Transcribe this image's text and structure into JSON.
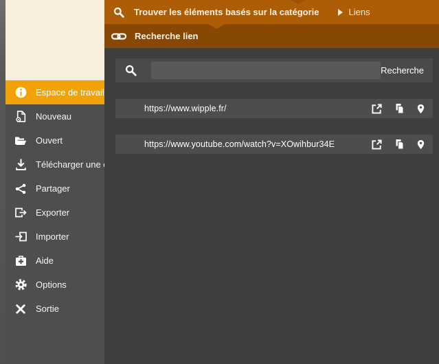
{
  "colors": {
    "topbar_orange": "#AC5D05",
    "subbar_brown": "#874803",
    "selected_orange": "#F2A206",
    "cream_panel": "#F9EEDC",
    "sidebar_gray": "#4E4E4E",
    "content_gray": "#3E3E3E",
    "panel_gray": "#4A4A4A",
    "row_gray": "#4D4D4D",
    "input_gray": "#595959"
  },
  "header": {
    "title": "Trouver les éléments basés sur la catégorie",
    "breadcrumb": "Liens",
    "subtitle": "Recherche lien"
  },
  "search": {
    "value": "",
    "placeholder": "",
    "button_label": "Recherche"
  },
  "sidebar": {
    "items": [
      {
        "label": "Espace de travail",
        "icon": "info",
        "selected": true
      },
      {
        "label": "Nouveau",
        "icon": "new-document",
        "selected": false
      },
      {
        "label": "Ouvert",
        "icon": "open-folder",
        "selected": false
      },
      {
        "label": "Télécharger une copie",
        "icon": "download",
        "selected": false
      },
      {
        "label": "Partager",
        "icon": "share",
        "selected": false
      },
      {
        "label": "Exporter",
        "icon": "export",
        "selected": false
      },
      {
        "label": "Importer",
        "icon": "import",
        "selected": false
      },
      {
        "label": "Aide",
        "icon": "first-aid",
        "selected": false
      },
      {
        "label": "Options",
        "icon": "gear",
        "selected": false
      },
      {
        "label": "Sortie",
        "icon": "close",
        "selected": false
      }
    ]
  },
  "links": [
    {
      "url": "https://www.wipple.fr/"
    },
    {
      "url": "https://www.youtube.com/watch?v=XOwihbur34E"
    }
  ]
}
